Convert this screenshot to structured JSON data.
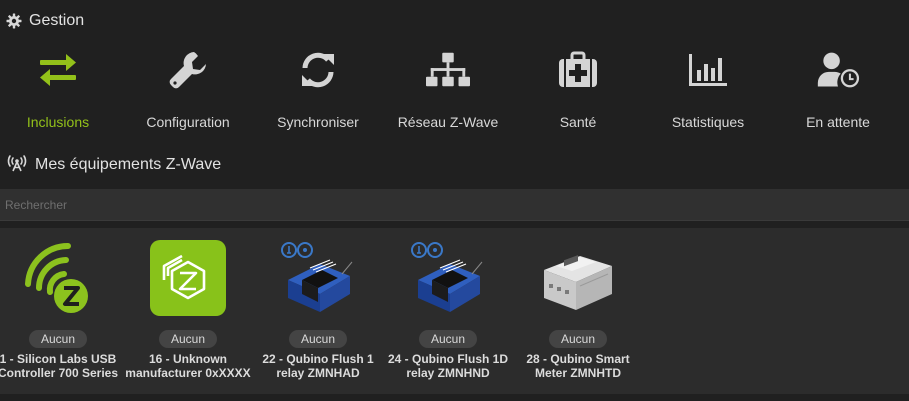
{
  "management": {
    "title": "Gestion",
    "title_icon": "gear-icon",
    "tiles": [
      {
        "label": "Inclusions",
        "icon": "exchange-arrows-icon",
        "active": true,
        "color": "#93c11a"
      },
      {
        "label": "Configuration",
        "icon": "wrench-icon",
        "active": false
      },
      {
        "label": "Synchroniser",
        "icon": "sync-icon",
        "active": false
      },
      {
        "label": "Réseau Z-Wave",
        "icon": "network-tree-icon",
        "active": false
      },
      {
        "label": "Santé",
        "icon": "medkit-icon",
        "active": false
      },
      {
        "label": "Statistiques",
        "icon": "bar-chart-icon",
        "active": false
      },
      {
        "label": "En attente",
        "icon": "user-clock-icon",
        "active": false
      }
    ]
  },
  "equipments": {
    "title": "Mes équipements Z-Wave",
    "title_icon": "antenna-icon",
    "search": {
      "placeholder": "Rechercher",
      "value": ""
    },
    "items": [
      {
        "badge": "Aucun",
        "name_line1": "1 - Silicon Labs USB",
        "name_line2": "Controller 700 Series",
        "image": "zwave-logo"
      },
      {
        "badge": "Aucun",
        "name_line1": "16 - Unknown",
        "name_line2": "manufacturer 0xXXXX",
        "image": "zwave-tile"
      },
      {
        "badge": "Aucun",
        "name_line1": "22 - Qubino Flush 1",
        "name_line2": "relay ZMNHAD",
        "image": "qubino-module"
      },
      {
        "badge": "Aucun",
        "name_line1": "24 - Qubino Flush 1D",
        "name_line2": "relay ZMNHND",
        "image": "qubino-module"
      },
      {
        "badge": "Aucun",
        "name_line1": "28 - Qubino Smart",
        "name_line2": "Meter ZMNHTD",
        "image": "din-meter"
      }
    ]
  }
}
